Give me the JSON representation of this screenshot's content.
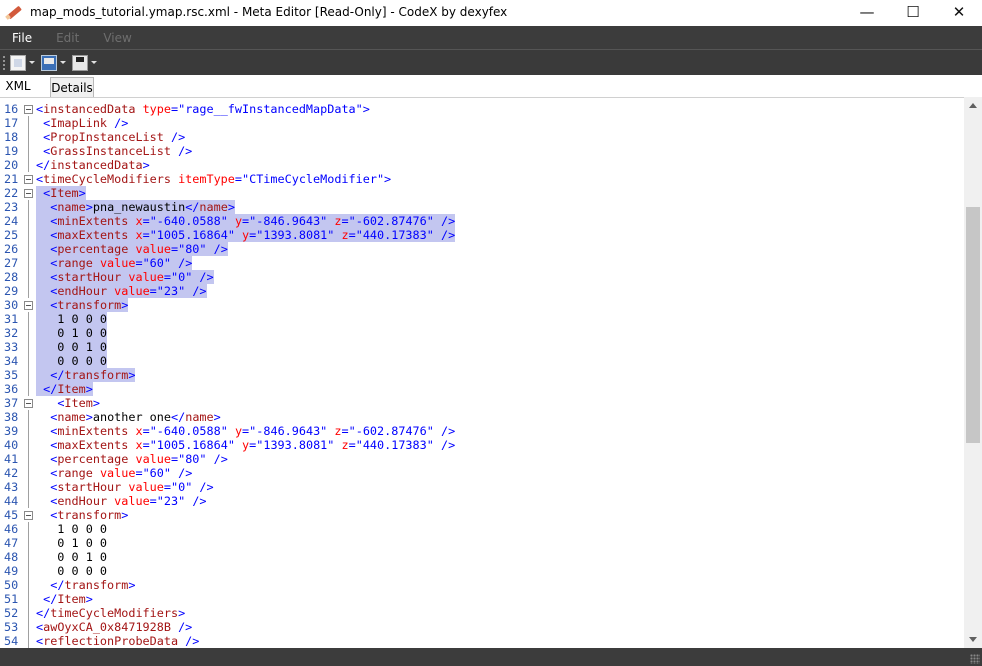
{
  "window": {
    "title": "map_mods_tutorial.ymap.rsc.xml - Meta Editor [Read-Only] - CodeX by dexyfex",
    "minimize": "—",
    "maximize": "☐",
    "close": "✕"
  },
  "menu": {
    "file": "File",
    "edit": "Edit",
    "view": "View"
  },
  "toolbar": {
    "icons": [
      "new-icon",
      "open-icon",
      "save-icon"
    ]
  },
  "tabs": {
    "xml": "XML",
    "details": "Details"
  },
  "editor": {
    "lines": [
      {
        "n": "16",
        "t": "<instancedData type=\"rage__fwInstancedMapData\">"
      },
      {
        "n": "17",
        "t": " <ImapLink />"
      },
      {
        "n": "18",
        "t": " <PropInstanceList />"
      },
      {
        "n": "19",
        "t": " <GrassInstanceList />"
      },
      {
        "n": "20",
        "t": "</instancedData>"
      },
      {
        "n": "21",
        "t": "<timeCycleModifiers itemType=\"CTimeCycleModifier\">"
      },
      {
        "n": "22",
        "t": " <Item>"
      },
      {
        "n": "23",
        "t": "  <name>pna_newaustin</name>"
      },
      {
        "n": "24",
        "t": "  <minExtents x=\"-640.0588\" y=\"-846.9643\" z=\"-602.87476\" />"
      },
      {
        "n": "25",
        "t": "  <maxExtents x=\"1005.16864\" y=\"1393.8081\" z=\"440.17383\" />"
      },
      {
        "n": "26",
        "t": "  <percentage value=\"80\" />"
      },
      {
        "n": "27",
        "t": "  <range value=\"60\" />"
      },
      {
        "n": "28",
        "t": "  <startHour value=\"0\" />"
      },
      {
        "n": "29",
        "t": "  <endHour value=\"23\" />"
      },
      {
        "n": "30",
        "t": "  <transform>"
      },
      {
        "n": "31",
        "t": "   1 0 0 0"
      },
      {
        "n": "32",
        "t": "   0 1 0 0"
      },
      {
        "n": "33",
        "t": "   0 0 1 0"
      },
      {
        "n": "34",
        "t": "   0 0 0 0"
      },
      {
        "n": "35",
        "t": "  </transform>"
      },
      {
        "n": "36",
        "t": " </Item>"
      },
      {
        "n": "37",
        "t": "   <Item>"
      },
      {
        "n": "38",
        "t": "  <name>another one</name>"
      },
      {
        "n": "39",
        "t": "  <minExtents x=\"-640.0588\" y=\"-846.9643\" z=\"-602.87476\" />"
      },
      {
        "n": "40",
        "t": "  <maxExtents x=\"1005.16864\" y=\"1393.8081\" z=\"440.17383\" />"
      },
      {
        "n": "41",
        "t": "  <percentage value=\"80\" />"
      },
      {
        "n": "42",
        "t": "  <range value=\"60\" />"
      },
      {
        "n": "43",
        "t": "  <startHour value=\"0\" />"
      },
      {
        "n": "44",
        "t": "  <endHour value=\"23\" />"
      },
      {
        "n": "45",
        "t": "  <transform>"
      },
      {
        "n": "46",
        "t": "   1 0 0 0"
      },
      {
        "n": "47",
        "t": "   0 1 0 0"
      },
      {
        "n": "48",
        "t": "   0 0 1 0"
      },
      {
        "n": "49",
        "t": "   0 0 0 0"
      },
      {
        "n": "50",
        "t": "  </transform>"
      },
      {
        "n": "51",
        "t": " </Item>"
      },
      {
        "n": "52",
        "t": "</timeCycleModifiers>"
      },
      {
        "n": "53",
        "t": "<awOyxCA_0x8471928B />"
      },
      {
        "n": "54",
        "t": "<reflectionProbeData />"
      }
    ],
    "fold_lines": [
      "16",
      "21",
      "22",
      "30",
      "37",
      "45"
    ],
    "selected_from": "22",
    "selected_to": "36"
  },
  "colors": {
    "menu_bg": "#3c3c3c",
    "selection": "#c3c6f0",
    "tag": "#a31515",
    "attr": "#ff0000",
    "value": "#0000ff",
    "line_number": "#2b55b0"
  }
}
